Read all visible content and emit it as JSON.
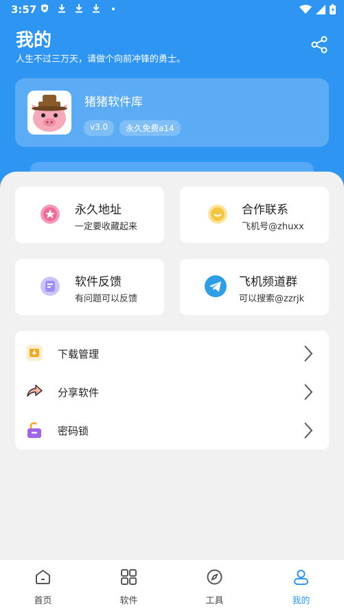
{
  "status_bar": {
    "time": "3:57"
  },
  "header": {
    "title": "我的",
    "subtitle": "人生不过三万天，请做个向前冲锋的勇士。"
  },
  "profile": {
    "app_name": "猪猪软件库",
    "version_badge": "v3.0",
    "license_badge": "永久免费a14"
  },
  "grid_cards": [
    {
      "title": "永久地址",
      "subtitle": "一定要收藏起来",
      "icon": "star-icon",
      "color": "#f06d9c"
    },
    {
      "title": "合作联系",
      "subtitle": "飞机号@zhuxx",
      "icon": "chat-icon",
      "color": "#f5c542"
    },
    {
      "title": "软件反馈",
      "subtitle": "有问题可以反馈",
      "icon": "feedback-icon",
      "color": "#9b8df2"
    },
    {
      "title": "飞机频道群",
      "subtitle": "可以搜索@zzrjk",
      "icon": "telegram-icon",
      "color": "#2f9ee6"
    }
  ],
  "list": [
    {
      "label": "下载管理",
      "icon": "download-folder-icon",
      "color": "#f5a623"
    },
    {
      "label": "分享软件",
      "icon": "share-arrow-icon",
      "color": "#f08b7a"
    },
    {
      "label": "密码锁",
      "icon": "lock-icon",
      "color": "#a066e8"
    }
  ],
  "nav": [
    {
      "label": "首页",
      "icon": "home-icon"
    },
    {
      "label": "软件",
      "icon": "apps-icon"
    },
    {
      "label": "工具",
      "icon": "compass-icon"
    },
    {
      "label": "我的",
      "icon": "profile-icon",
      "active": true
    }
  ],
  "colors": {
    "primary": "#2f95f3",
    "background": "#f1f1f1"
  }
}
